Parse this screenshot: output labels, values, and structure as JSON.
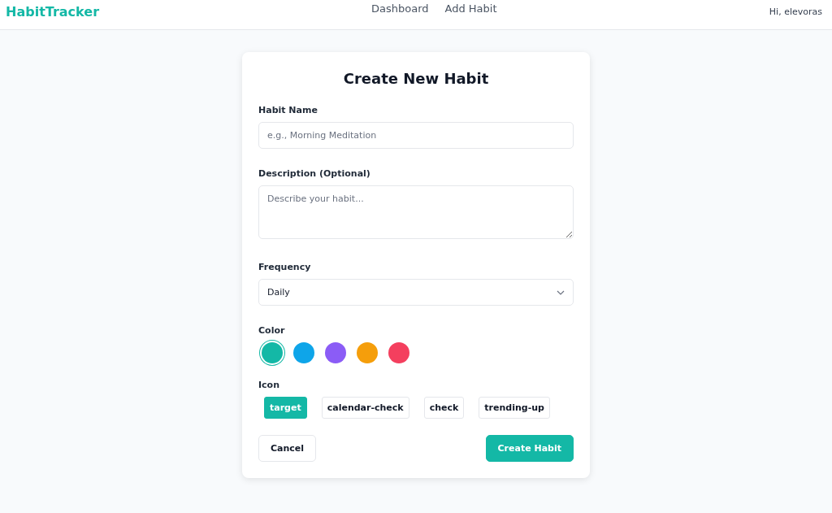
{
  "header": {
    "logo": "HabitTracker",
    "nav": [
      {
        "label": "Dashboard"
      },
      {
        "label": "Add Habit"
      }
    ],
    "greeting": "Hi, elevoras"
  },
  "form": {
    "title": "Create New Habit",
    "name_field": {
      "label": "Habit Name",
      "placeholder": "e.g., Morning Meditation"
    },
    "description_field": {
      "label": "Description (Optional)",
      "placeholder": "Describe your habit..."
    },
    "frequency_field": {
      "label": "Frequency",
      "value": "Daily"
    },
    "color_label": "Color",
    "colors": [
      {
        "color": "#14b8a6",
        "selected": true
      },
      {
        "color": "#0ea5e9",
        "selected": false
      },
      {
        "color": "#8b5cf6",
        "selected": false
      },
      {
        "color": "#f59e0b",
        "selected": false
      },
      {
        "color": "#f43f5e",
        "selected": false
      }
    ],
    "icon_label": "Icon",
    "icons": [
      {
        "label": "target",
        "selected": true
      },
      {
        "label": "calendar-check",
        "selected": false
      },
      {
        "label": "check",
        "selected": false
      },
      {
        "label": "trending-up",
        "selected": false
      }
    ],
    "cancel_button": "Cancel",
    "submit_button": "Create Habit"
  }
}
